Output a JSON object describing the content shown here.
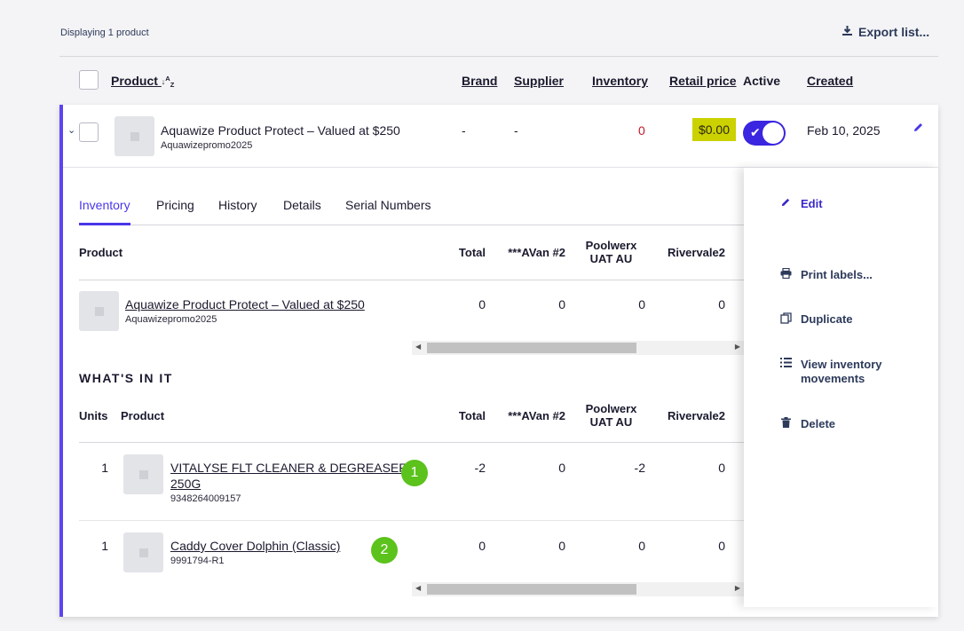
{
  "top": {
    "displaying": "Displaying 1 product",
    "export_label": "Export list..."
  },
  "columns": {
    "product": "Product",
    "brand": "Brand",
    "supplier": "Supplier",
    "inventory": "Inventory",
    "retail_price": "Retail price",
    "active": "Active",
    "created": "Created"
  },
  "product_row": {
    "name": "Aquawize Product Protect – Valued at $250",
    "sku": "Aquawizepromo2025",
    "brand": "-",
    "supplier": "-",
    "inventory": "0",
    "retail_price": "$0.00",
    "active": true,
    "created": "Feb 10, 2025"
  },
  "tabs": [
    "Inventory",
    "Pricing",
    "History",
    "Details",
    "Serial Numbers"
  ],
  "inventory_table": {
    "headers": {
      "product": "Product",
      "total": "Total",
      "avan": "***AVan #2",
      "poolwerx_1": "Poolwerx",
      "poolwerx_2": "UAT AU",
      "rivervale": "Rivervale2"
    },
    "row": {
      "name": "Aquawize Product Protect – Valued at $250",
      "sku": "Aquawizepromo2025",
      "total": "0",
      "avan": "0",
      "poolwerx": "0",
      "rivervale": "0"
    }
  },
  "whats_in_it": {
    "title": "WHAT'S IN IT",
    "headers": {
      "units": "Units",
      "product": "Product",
      "total": "Total",
      "avan": "***AVan #2",
      "poolwerx_1": "Poolwerx",
      "poolwerx_2": "UAT AU",
      "rivervale": "Rivervale2"
    },
    "rows": [
      {
        "units": "1",
        "name_1": "VITALYSE FLT CLEANER & DEGREASER -",
        "name_2": "250G",
        "sku": "9348264009157",
        "badge": "1",
        "total": "-2",
        "avan": "0",
        "poolwerx": "-2",
        "rivervale": "0"
      },
      {
        "units": "1",
        "name_1": "Caddy Cover Dolphin (Classic)",
        "sku": "9991794-R1",
        "badge": "2",
        "total": "0",
        "avan": "0",
        "poolwerx": "0",
        "rivervale": "0"
      }
    ]
  },
  "actions": {
    "edit": "Edit",
    "print": "Print labels...",
    "duplicate": "Duplicate",
    "movements_1": "View inventory",
    "movements_2": "movements",
    "delete": "Delete"
  },
  "colors": {
    "accent": "#4a36e8",
    "price_badge": "#ccd100",
    "badge_green": "#5cc21c",
    "negative": "#c0182a"
  }
}
